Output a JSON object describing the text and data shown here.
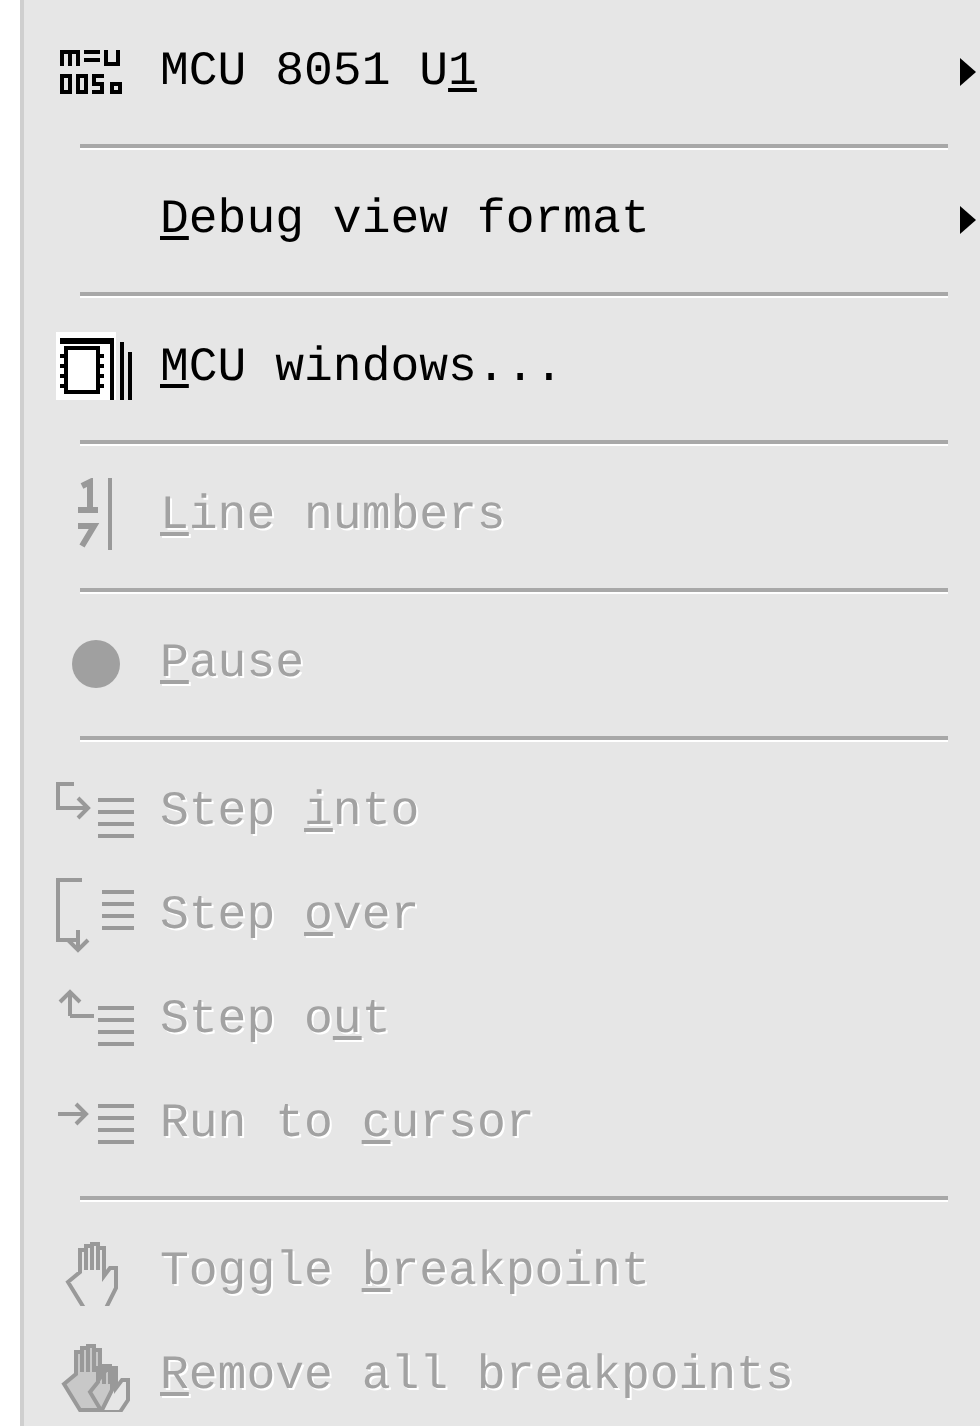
{
  "menu": {
    "items": [
      {
        "kind": "item",
        "before": "MCU 8051 U",
        "key": "1",
        "disabled": false,
        "submenu": true
      },
      {
        "kind": "separator"
      },
      {
        "kind": "item",
        "key": "D",
        "after": "ebug view format",
        "disabled": false,
        "submenu": true
      },
      {
        "kind": "separator"
      },
      {
        "kind": "item",
        "key": "M",
        "after": "CU windows...",
        "disabled": false,
        "submenu": false
      },
      {
        "kind": "separator"
      },
      {
        "kind": "item",
        "key": "L",
        "after": "ine numbers",
        "disabled": true,
        "submenu": false
      },
      {
        "kind": "separator"
      },
      {
        "kind": "item",
        "key": "P",
        "after": "ause",
        "disabled": true,
        "submenu": false
      },
      {
        "kind": "separator"
      },
      {
        "kind": "item",
        "before": "Step ",
        "key": "i",
        "after": "nto",
        "disabled": true,
        "submenu": false
      },
      {
        "kind": "item",
        "before": "Step ",
        "key": "o",
        "after": "ver",
        "disabled": true,
        "submenu": false
      },
      {
        "kind": "item",
        "before": "Step o",
        "key": "u",
        "after": "t",
        "disabled": true,
        "submenu": false
      },
      {
        "kind": "item",
        "before": "Run to ",
        "key": "c",
        "after": "ursor",
        "disabled": true,
        "submenu": false
      },
      {
        "kind": "separator"
      },
      {
        "kind": "item",
        "before": "Toggle ",
        "key": "b",
        "after": "reakpoint",
        "disabled": true,
        "submenu": false
      },
      {
        "kind": "item",
        "key": "R",
        "after": "emove all breakpoints",
        "disabled": true,
        "submenu": false
      }
    ]
  }
}
